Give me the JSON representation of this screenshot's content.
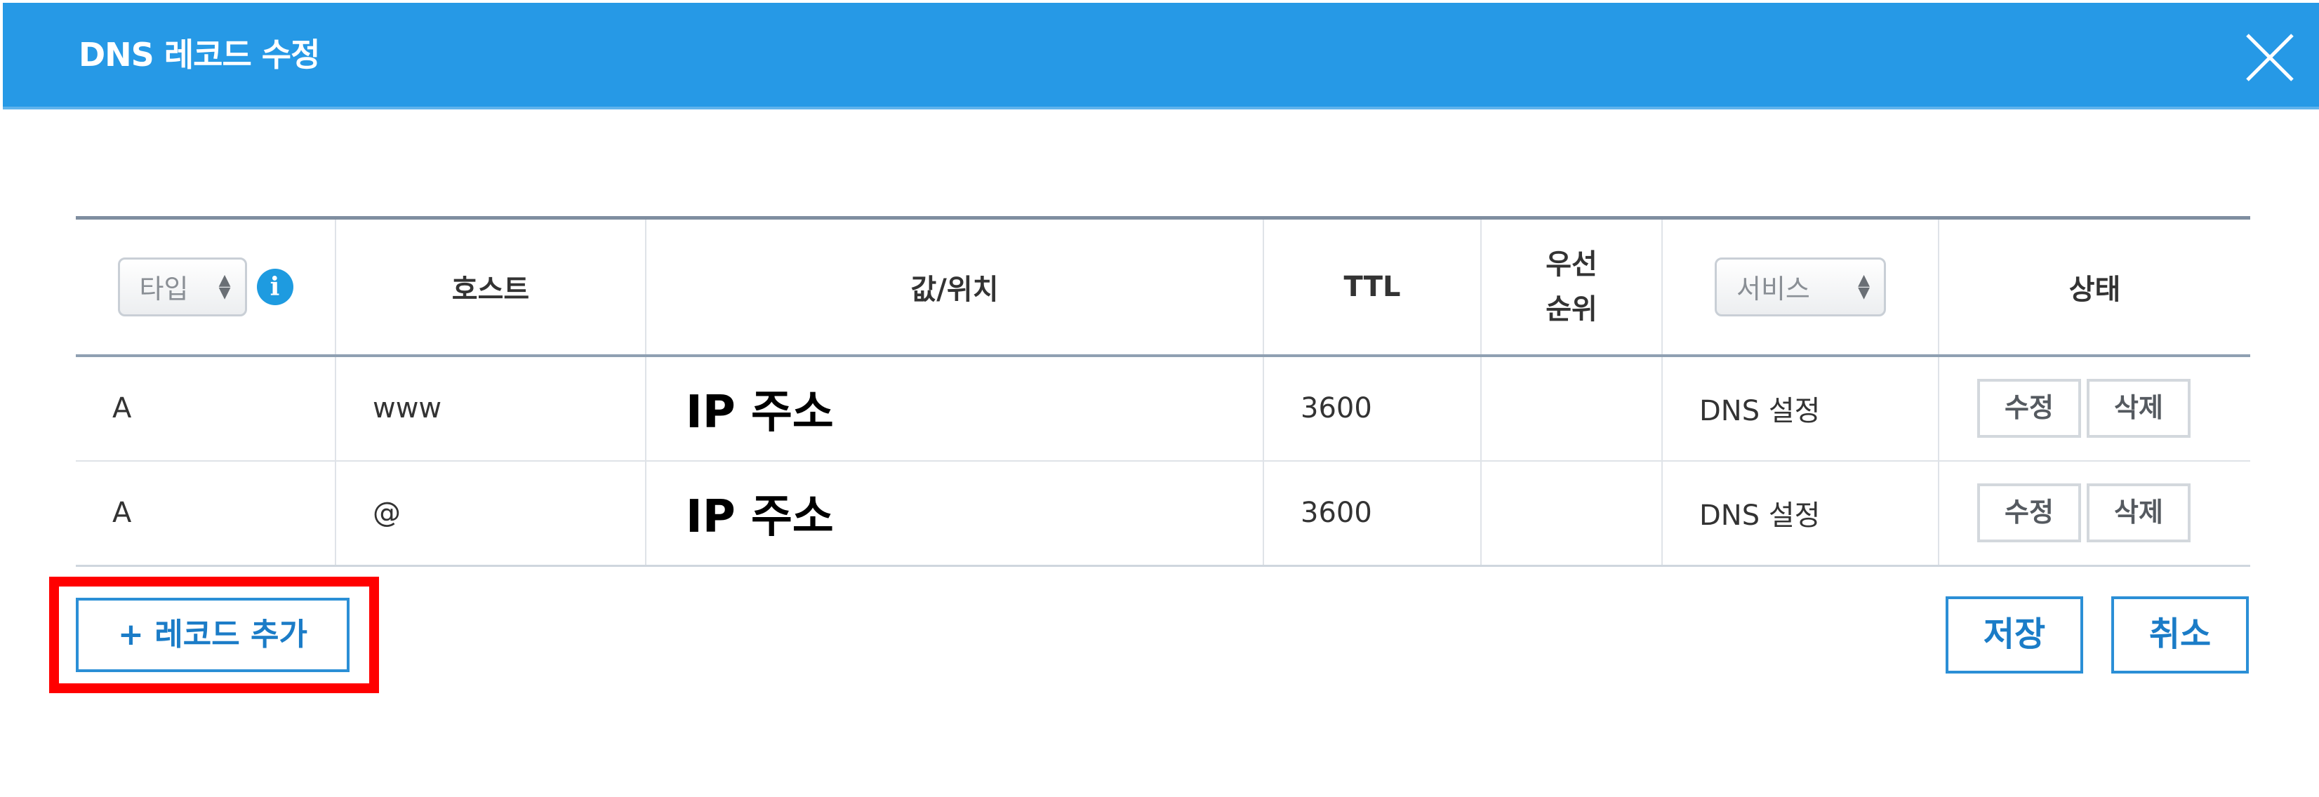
{
  "dialog": {
    "title": "DNS 레코드 수정",
    "close_icon": "close-icon"
  },
  "table": {
    "headers": {
      "type_select": "타입",
      "host": "호스트",
      "value": "값/위치",
      "ttl": "TTL",
      "priority_line1": "우선",
      "priority_line2": "순위",
      "service_select": "서비스",
      "status": "상태"
    },
    "rows": [
      {
        "type": "A",
        "host": "www",
        "value": "IP 주소",
        "ttl": "3600",
        "priority": "",
        "service": "DNS 설정",
        "edit_label": "수정",
        "delete_label": "삭제"
      },
      {
        "type": "A",
        "host": "@",
        "value": "IP 주소",
        "ttl": "3600",
        "priority": "",
        "service": "DNS 설정",
        "edit_label": "수정",
        "delete_label": "삭제"
      }
    ]
  },
  "actions": {
    "add_record_label": "+ 레코드 추가",
    "save_label": "저장",
    "cancel_label": "취소"
  },
  "colors": {
    "titlebar": "#2699e6",
    "accent": "#2b8fd6",
    "highlight": "#ff0000",
    "info_icon": "#1e9be0"
  }
}
